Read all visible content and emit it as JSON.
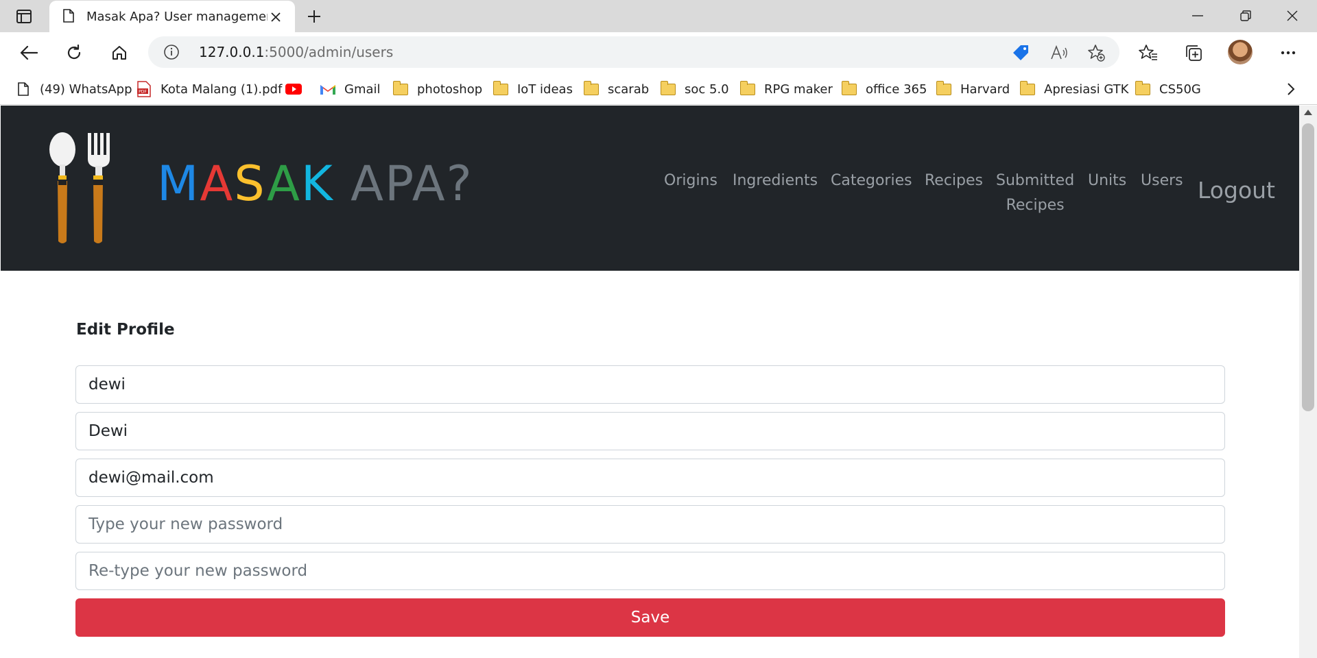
{
  "browser": {
    "tab_title": "Masak Apa? User management",
    "url_host": "127.0.0.1",
    "url_rest": ":5000/admin/users",
    "bookmarks": [
      {
        "label": "(49) WhatsApp",
        "icon": "page-icon"
      },
      {
        "label": "Kota Malang (1).pdf",
        "icon": "pdf-icon"
      },
      {
        "label": "",
        "icon": "youtube-icon"
      },
      {
        "label": "Gmail",
        "icon": "gmail-icon"
      },
      {
        "label": "photoshop",
        "icon": "folder-icon"
      },
      {
        "label": "IoT ideas",
        "icon": "folder-icon"
      },
      {
        "label": "scarab",
        "icon": "folder-icon"
      },
      {
        "label": "soc 5.0",
        "icon": "folder-icon"
      },
      {
        "label": "RPG maker",
        "icon": "folder-icon"
      },
      {
        "label": "office 365",
        "icon": "folder-icon"
      },
      {
        "label": "Harvard",
        "icon": "folder-icon"
      },
      {
        "label": "Apresiasi GTK",
        "icon": "folder-icon"
      },
      {
        "label": "CS50G",
        "icon": "folder-icon"
      }
    ]
  },
  "header": {
    "logo_letters": [
      {
        "char": "M",
        "color": "#1e88e5"
      },
      {
        "char": "A",
        "color": "#e53935"
      },
      {
        "char": "S",
        "color": "#fbc02d"
      },
      {
        "char": "A",
        "color": "#2e9d46"
      },
      {
        "char": "K",
        "color": "#12b6e0"
      },
      {
        "char": " ",
        "color": "#6c757d"
      },
      {
        "char": "A",
        "color": "#6c757d"
      },
      {
        "char": "P",
        "color": "#6c757d"
      },
      {
        "char": "A",
        "color": "#6c757d"
      },
      {
        "char": "?",
        "color": "#6c757d"
      }
    ],
    "nav": {
      "origins": "Origins",
      "ingredients": "Ingredients",
      "categories": "Categories",
      "recipes": "Recipes",
      "submitted_line1": "Submitted",
      "submitted_line2": "Recipes",
      "units": "Units",
      "users": "Users",
      "logout": "Logout"
    }
  },
  "form": {
    "title": "Edit Profile",
    "username": "dewi",
    "name": "Dewi",
    "email": "dewi@mail.com",
    "password_placeholder": "Type your new password",
    "retype_placeholder": "Re-type your new password",
    "save_label": "Save"
  },
  "colors": {
    "header_bg": "#212529",
    "save_bg": "#dc3545",
    "nav_text": "#9aa0a6"
  }
}
